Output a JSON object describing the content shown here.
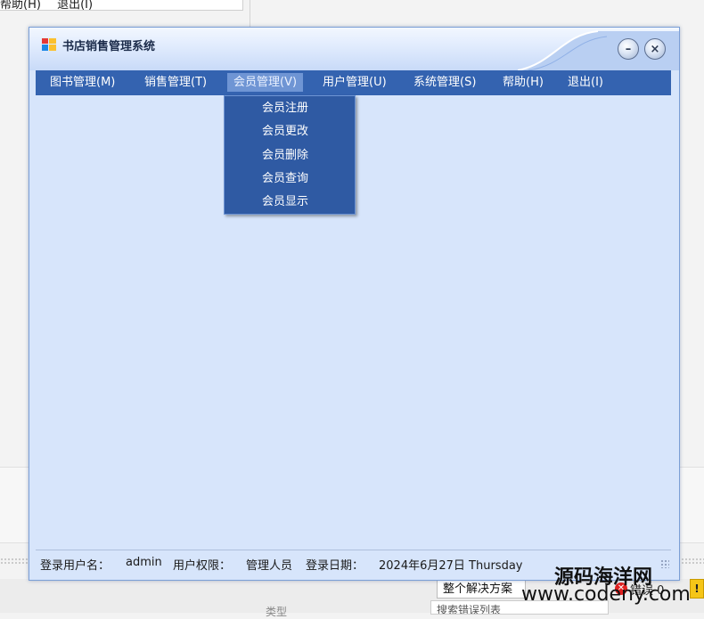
{
  "background": {
    "top_menu": [
      "帮助(H)",
      "退出(I)"
    ],
    "solution_dropdown": "整个解决方案",
    "error_label": "错误 0",
    "type_label": "类型",
    "search_list": "搜索错误列表"
  },
  "window": {
    "title": "书店销售管理系统",
    "minimize_glyph": "–",
    "close_glyph": "×"
  },
  "menu": {
    "items": [
      {
        "label": "图书管理(M)"
      },
      {
        "label": "销售管理(T)"
      },
      {
        "label": "会员管理(V)"
      },
      {
        "label": "用户管理(U)"
      },
      {
        "label": "系统管理(S)"
      },
      {
        "label": "帮助(H)"
      },
      {
        "label": "退出(I)"
      }
    ],
    "active": "会员管理(V)"
  },
  "dropdown": {
    "items": [
      "会员注册",
      "会员更改",
      "会员删除",
      "会员查询",
      "会员显示"
    ]
  },
  "status": {
    "user_label": "登录用户名：",
    "user_value": "admin",
    "role_label": "用户权限：",
    "role_value": "管理人员",
    "date_label": "登录日期：",
    "date_value": "2024年6月27日 Thursday"
  },
  "watermark": {
    "cn": "源码海洋网",
    "url": "www.codeny.com"
  },
  "colors": {
    "menu_bar": "#3463b0",
    "menu_active": "#6f95d4",
    "dropdown": "#2f5aa3",
    "client_area": "#d7e5fb"
  }
}
